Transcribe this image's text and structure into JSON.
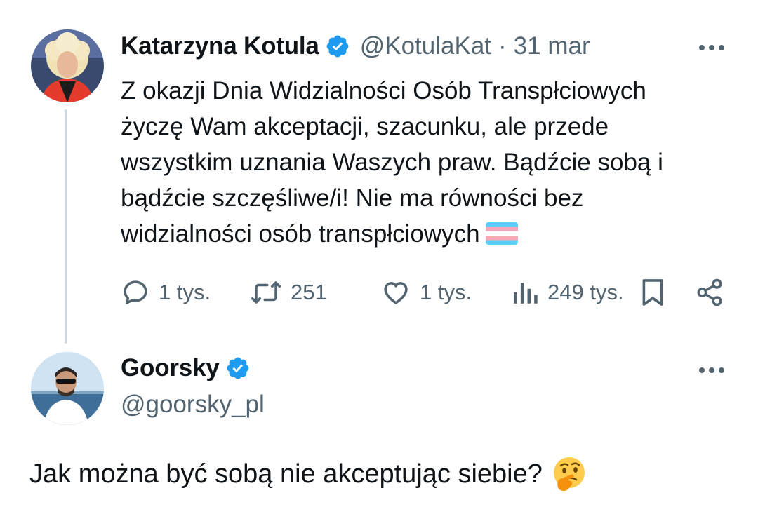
{
  "tweet": {
    "author_name": "Katarzyna Kotula",
    "author_handle": "@KotulaKat",
    "separator": "·",
    "date": "31 mar",
    "lines": [
      "Z okazji Dnia Widzialności Osób Transpłciowych",
      "życzę Wam akceptacji, szacunku, ale przede",
      "wszystkim uznania Waszych praw. Bądźcie sobą i",
      "bądźcie szczęśliwe/i! Nie ma równości bez",
      "widzialności osób transpłciowych"
    ],
    "emoji_icon": "transgender-flag-icon",
    "stats": {
      "replies": "1 tys.",
      "reposts": "251",
      "likes": "1 tys.",
      "views": "249 tys."
    }
  },
  "reply": {
    "author_name": "Goorsky",
    "author_handle": "@goorsky_pl",
    "text": "Jak można być sobą nie akceptując siebie?",
    "emoji_icon": "thinking-face-icon"
  },
  "colors": {
    "verified_blue": "#1d9bf0",
    "muted_text": "#536471",
    "primary_text": "#0f1419",
    "thread_line": "#cfd9de"
  }
}
